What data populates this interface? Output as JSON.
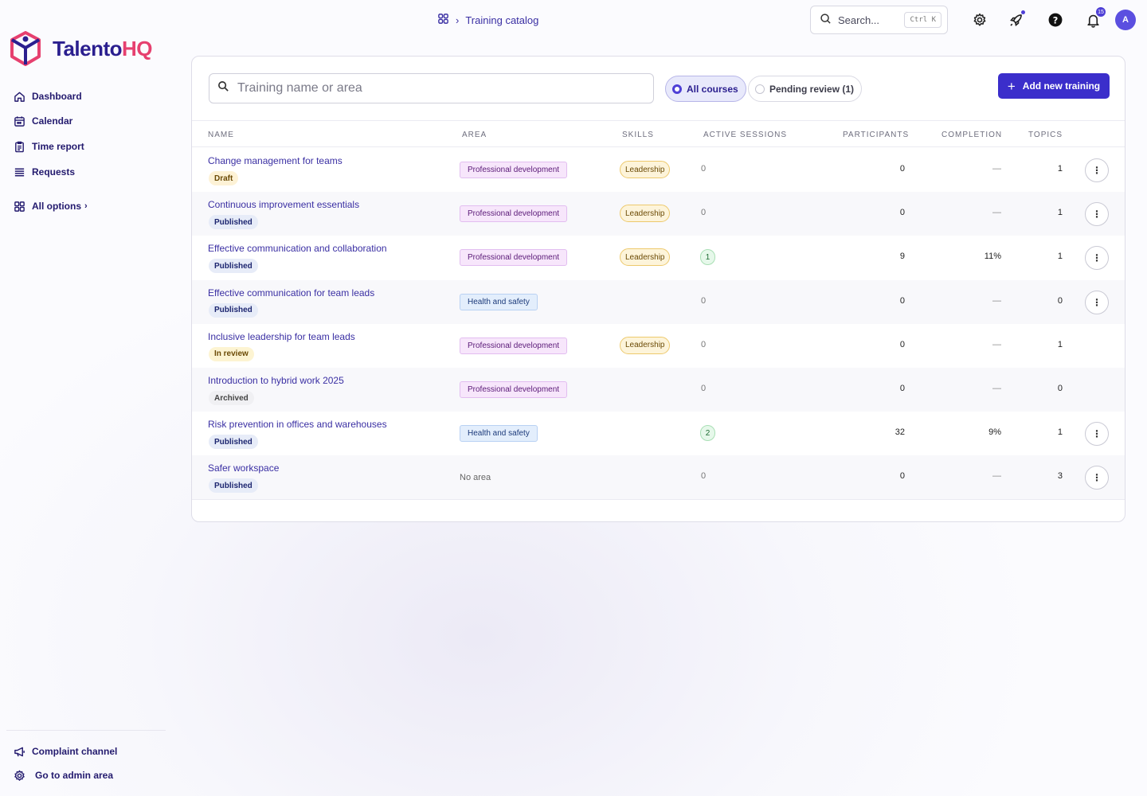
{
  "brand": {
    "name_main": "Talento",
    "name_accent": "HQ",
    "colors": {
      "primary": "#3b2ecb",
      "accent": "#e6406f"
    }
  },
  "breadcrumb": {
    "icon": "grid-icon",
    "current": "Training catalog"
  },
  "top_search": {
    "placeholder": "Search...",
    "shortcut": "Ctrl K"
  },
  "top_icons": {
    "settings": "gear-icon",
    "launch": "rocket-icon",
    "help": "help-icon",
    "notifications": "bell-icon",
    "notification_count": "15"
  },
  "avatar_initial": "A",
  "sidebar": {
    "items": [
      {
        "label": "Dashboard",
        "icon": "home-icon"
      },
      {
        "label": "Calendar",
        "icon": "calendar-icon"
      },
      {
        "label": "Time report",
        "icon": "clipboard-icon"
      },
      {
        "label": "Requests",
        "icon": "list-icon"
      }
    ],
    "all_options": "All options",
    "footer": [
      {
        "label": "Complaint channel",
        "icon": "megaphone-icon"
      },
      {
        "label": "Go to admin area",
        "icon": "gear-icon"
      }
    ]
  },
  "filters": {
    "search_placeholder": "Training name or area",
    "all_courses": "All courses",
    "pending_review": "Pending review (1)",
    "add_button": "Add new training"
  },
  "table": {
    "columns": [
      "Name",
      "Area",
      "Skills",
      "Active sessions",
      "Participants",
      "Completion",
      "Topics"
    ],
    "rows": [
      {
        "name": "Change management for teams",
        "status": "Draft",
        "area": "Professional development",
        "skill": "Leadership",
        "sessions": "0",
        "participants": "0",
        "completion": "—",
        "topics": "1",
        "menu": true
      },
      {
        "name": "Continuous improvement essentials",
        "status": "Published",
        "area": "Professional development",
        "skill": "Leadership",
        "sessions": "0",
        "participants": "0",
        "completion": "—",
        "topics": "1",
        "menu": true
      },
      {
        "name": "Effective communication and collaboration",
        "status": "Published",
        "area": "Professional development",
        "skill": "Leadership",
        "sessions": "1",
        "participants": "9",
        "completion": "11%",
        "topics": "1",
        "menu": true
      },
      {
        "name": "Effective communication for team leads",
        "status": "Published",
        "area": "Health and safety",
        "skill": "",
        "sessions": "0",
        "participants": "0",
        "completion": "—",
        "topics": "0",
        "menu": true
      },
      {
        "name": "Inclusive leadership for team leads",
        "status": "In review",
        "area": "Professional development",
        "skill": "Leadership",
        "sessions": "0",
        "participants": "0",
        "completion": "—",
        "topics": "1",
        "menu": false
      },
      {
        "name": "Introduction to hybrid work 2025",
        "status": "Archived",
        "area": "Professional development",
        "skill": "",
        "sessions": "0",
        "participants": "0",
        "completion": "—",
        "topics": "0",
        "menu": false
      },
      {
        "name": "Risk prevention in offices and warehouses",
        "status": "Published",
        "area": "Health and safety",
        "skill": "",
        "sessions": "2",
        "participants": "32",
        "completion": "9%",
        "topics": "1",
        "menu": true
      },
      {
        "name": "Safer workspace",
        "status": "Published",
        "area": "No area",
        "skill": "",
        "sessions": "0",
        "participants": "0",
        "completion": "—",
        "topics": "3",
        "menu": true
      }
    ]
  }
}
